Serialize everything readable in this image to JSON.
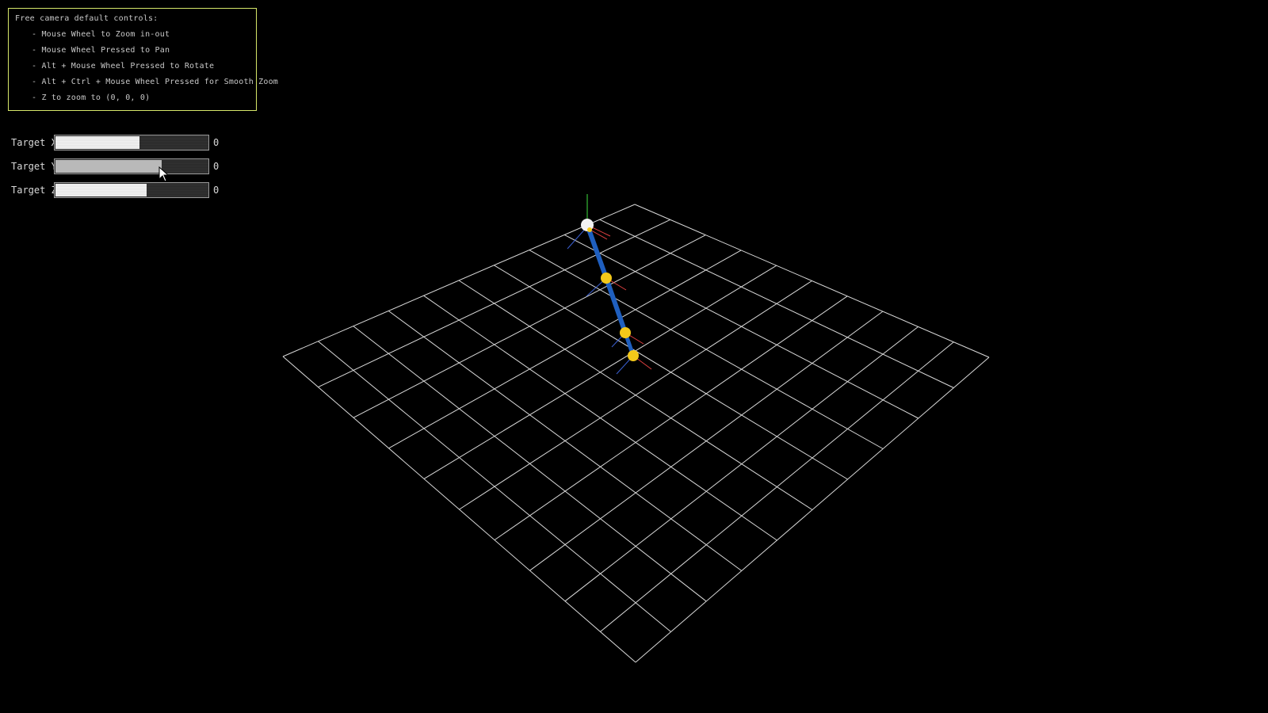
{
  "help": {
    "title": "Free camera default controls:",
    "items": [
      "- Mouse Wheel to Zoom in-out",
      "- Mouse Wheel Pressed to Pan",
      "- Alt + Mouse Wheel Pressed to Rotate",
      "- Alt + Ctrl + Mouse Wheel Pressed for Smooth Zoom",
      "- Z to zoom to (0, 0, 0)"
    ],
    "border_color": "#d7e86a"
  },
  "sliders": [
    {
      "label": "Target X",
      "value": "0",
      "fill": 0.55,
      "active": false
    },
    {
      "label": "Target Y",
      "value": "0",
      "fill": 0.7,
      "active": true
    },
    {
      "label": "Target Z",
      "value": "0",
      "fill": 0.6,
      "active": false
    }
  ],
  "scene": {
    "background": "#000000",
    "grid_color": "#d9d9d9",
    "grid_divisions": 10,
    "bone_color": "#1f5fbf",
    "joint_color": "#f3c81a",
    "root_joint_color": "#f2f2f2",
    "axis_x_color": "#e04040",
    "axis_y_color": "#40e040",
    "axis_z_color": "#3a5fd0",
    "icons": [
      "cursor-arrow-icon"
    ]
  }
}
